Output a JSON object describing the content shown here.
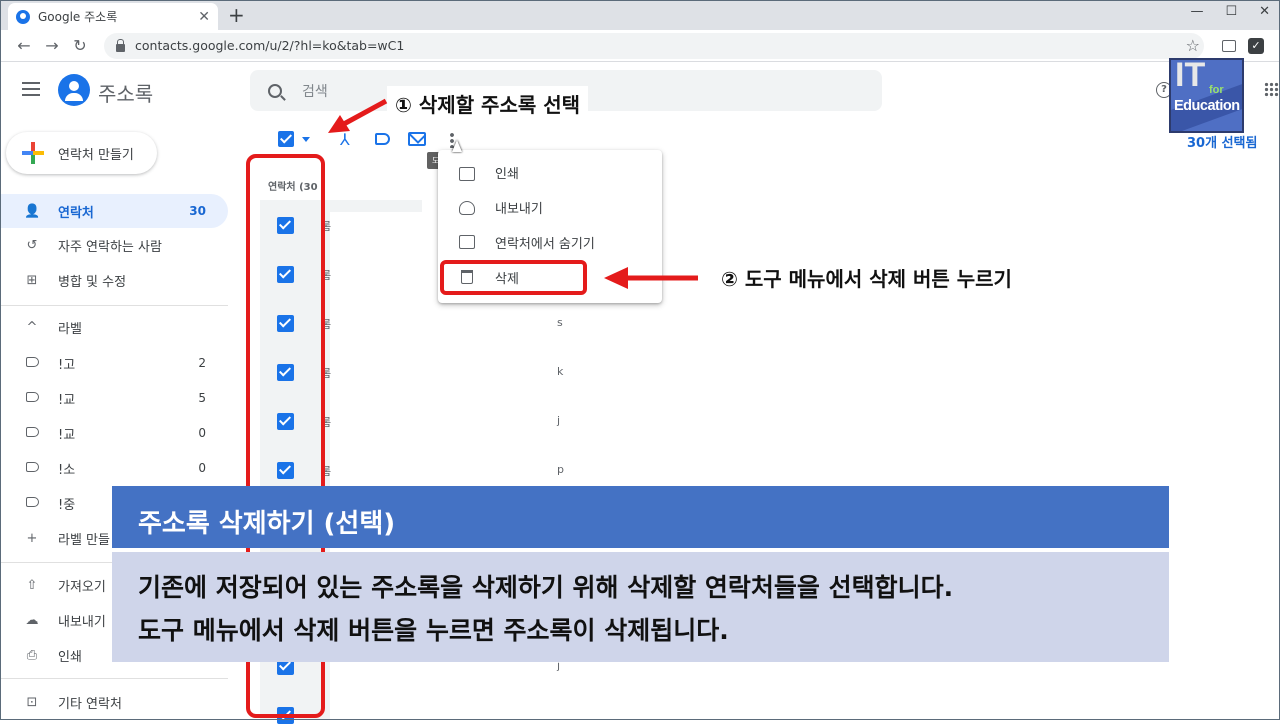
{
  "browser": {
    "tab_title": "Google 주소록",
    "tab_close": "✕",
    "new_tab": "+",
    "url": "contacts.google.com/u/2/?hl=ko&tab=wC1",
    "win_min": "—",
    "win_max": "☐",
    "win_close": "✕"
  },
  "app": {
    "title": "주소록",
    "search_placeholder": "검색",
    "help": "?",
    "create_label": "연락처 만들기",
    "selection_status": "30개 선택됨",
    "tooltip": "도구 보기"
  },
  "logo": {
    "it": "IT",
    "for": "for",
    "education": "Education"
  },
  "sidebar": {
    "items": [
      {
        "label": "연락처",
        "count": "30",
        "icon": "person-icon"
      },
      {
        "label": "자주 연락하는 사람",
        "icon": "history-icon"
      },
      {
        "label": "병합 및 수정",
        "icon": "merge-icon"
      }
    ],
    "labels_header": "라벨",
    "labels": [
      {
        "label": "!고",
        "count": "2"
      },
      {
        "label": "!교",
        "count": "5"
      },
      {
        "label": "!교",
        "count": "0"
      },
      {
        "label": "!소",
        "count": "0"
      },
      {
        "label": "!중",
        "count": ""
      }
    ],
    "create_label": "라벨 만들",
    "import": "가져오기",
    "export": "내보내기",
    "print": "인쇄",
    "other_contacts": "기타 연락처"
  },
  "list": {
    "header": "연락처 (30 )",
    "fragments_a": [
      "s",
      "k",
      "j",
      "p",
      "j"
    ],
    "fragments_b": [
      "롬",
      "롬",
      "롬",
      "롬",
      "롬",
      "롬"
    ]
  },
  "menu": {
    "items": [
      {
        "label": "인쇄"
      },
      {
        "label": "내보내기"
      },
      {
        "label": "연락처에서 숨기기"
      },
      {
        "label": "삭제"
      }
    ]
  },
  "annotations": {
    "step1": "① 삭제할 주소록 선택",
    "step2": "② 도구 메뉴에서 삭제 버튼 누르기"
  },
  "caption": {
    "title": "주소록 삭제하기 (선택)",
    "line1": "기존에 저장되어 있는 주소록을 삭제하기 위해 삭제할 연락처들을 선택합니다.",
    "line2": "도구 메뉴에서 삭제 버튼을 누르면 주소록이 삭제됩니다."
  },
  "colors": {
    "accent": "#1a73e8",
    "annotation_red": "#e41b1b",
    "caption_title_bg": "#4472c4",
    "caption_body_bg": "#cfd5ea"
  }
}
